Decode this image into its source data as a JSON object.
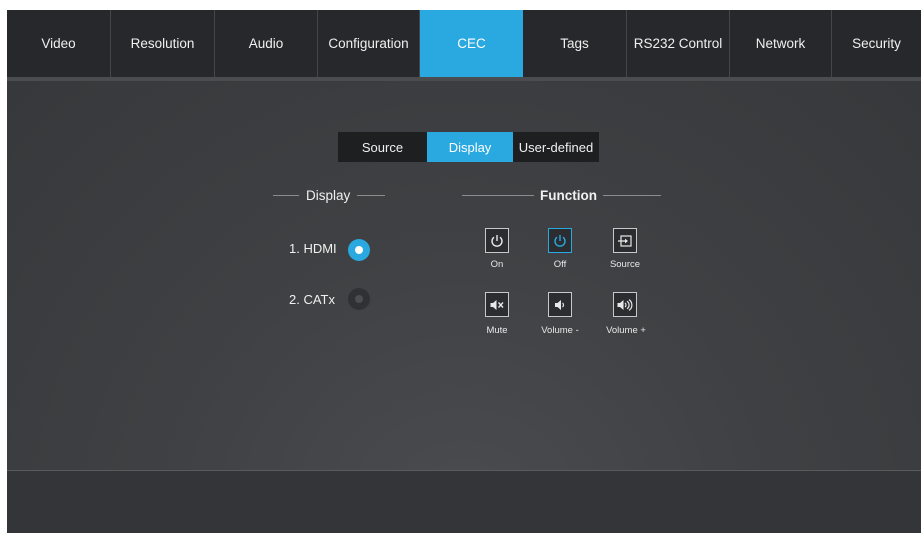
{
  "nav": {
    "tabs": [
      {
        "label": "Video"
      },
      {
        "label": "Resolution"
      },
      {
        "label": "Audio"
      },
      {
        "label": "Configuration"
      },
      {
        "label": "CEC",
        "active": true
      },
      {
        "label": "Tags"
      },
      {
        "label": "RS232 Control"
      },
      {
        "label": "Network"
      },
      {
        "label": "Security"
      }
    ]
  },
  "subtabs": [
    {
      "label": "Source"
    },
    {
      "label": "Display",
      "active": true
    },
    {
      "label": "User-defined"
    }
  ],
  "display_section": {
    "title": "Display",
    "options": [
      {
        "label": "1. HDMI",
        "selected": true
      },
      {
        "label": "2. CATx",
        "selected": false
      }
    ]
  },
  "function_section": {
    "title": "Function",
    "buttons": [
      {
        "label": "On",
        "icon": "power-icon"
      },
      {
        "label": "Off",
        "icon": "power-icon",
        "selected": true
      },
      {
        "label": "Source",
        "icon": "source-input-icon"
      },
      {
        "label": "Mute",
        "icon": "mute-icon"
      },
      {
        "label": "Volume -",
        "icon": "volume-down-icon"
      },
      {
        "label": "Volume +",
        "icon": "volume-up-icon"
      }
    ]
  },
  "colors": {
    "accent": "#2aa8e0",
    "nav_bg": "#26282b",
    "content_bg": "#3c3e41"
  }
}
